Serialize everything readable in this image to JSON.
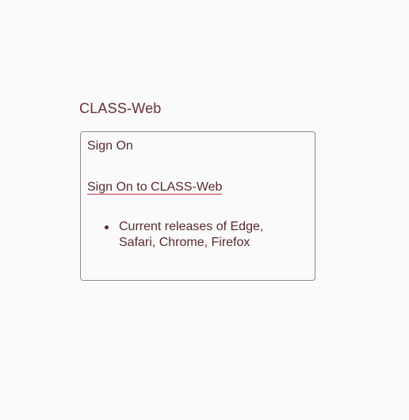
{
  "page": {
    "title": "CLASS-Web"
  },
  "signon_panel": {
    "heading": "Sign On",
    "link_label": "Sign On to CLASS-Web",
    "requirements": [
      "Current releases of Edge, Safari, Chrome, Firefox"
    ]
  },
  "colors": {
    "text": "#5a2a2e",
    "title": "#6b2e35",
    "link_underline": "#c0303c",
    "box_border": "#8a8a8a",
    "background": "#fafafa"
  }
}
